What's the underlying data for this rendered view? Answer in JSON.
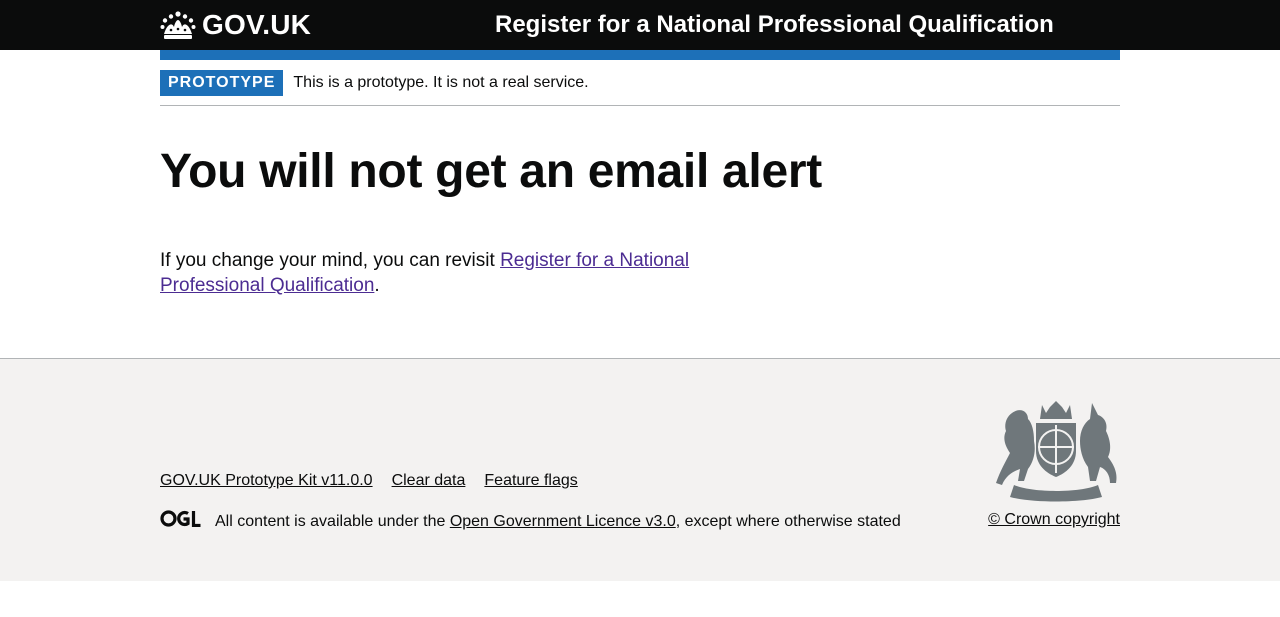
{
  "header": {
    "logo_text": "GOV.UK",
    "logo_icon": "crown-icon",
    "service_name": "Register for a National Professional Qualification",
    "accent_color": "#1d70b8",
    "background_color": "#0b0c0c"
  },
  "phase_banner": {
    "tag": "PROTOTYPE",
    "text": "This is a prototype. It is not a real service."
  },
  "main": {
    "heading": "You will not get an email alert",
    "body_prefix": "If you change your mind, you can revisit ",
    "body_link": "Register for a National Professional Qualification",
    "body_suffix": ".",
    "link_color": "#4c2c92"
  },
  "footer": {
    "links": [
      "GOV.UK Prototype Kit v11.0.0",
      "Clear data",
      "Feature flags"
    ],
    "ogl_icon": "ogl-logo-icon",
    "licence_prefix": "All content is available under the ",
    "licence_link": "Open Government Licence v3.0",
    "licence_suffix": ", except where otherwise stated",
    "crest_icon": "royal-coat-of-arms-icon",
    "copyright": "© Crown copyright",
    "background_color": "#f3f2f1"
  }
}
